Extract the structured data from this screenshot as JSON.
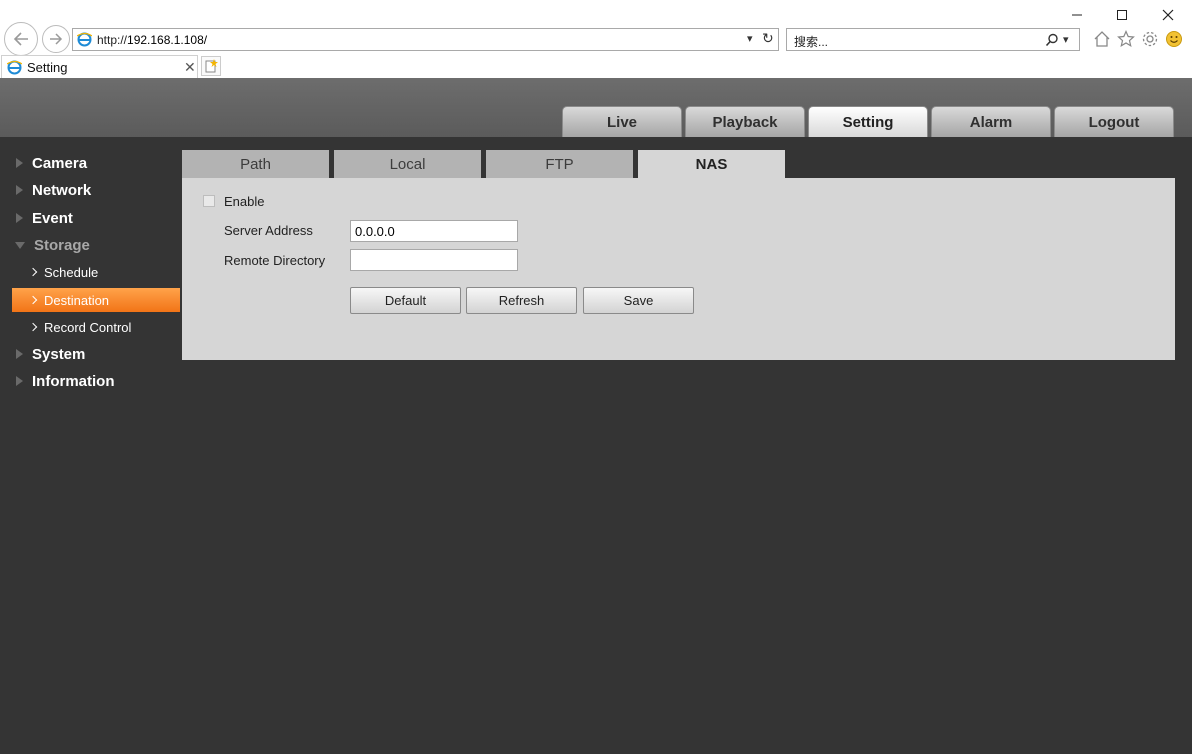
{
  "browser": {
    "url_prefix": "http://",
    "url_host": "192.168.1.108/",
    "search_placeholder": "搜索...",
    "tab_title": "Setting",
    "icons": [
      "back-arrow-icon",
      "forward-arrow-icon",
      "ie-logo-icon",
      "dropdown-icon",
      "refresh-icon",
      "search-icon",
      "home-icon",
      "favorites-star-icon",
      "gear-icon",
      "smiley-icon",
      "minimize-icon",
      "maximize-icon",
      "close-icon",
      "new-tab-icon"
    ]
  },
  "header": {
    "tabs": [
      {
        "label": "Live"
      },
      {
        "label": "Playback"
      },
      {
        "label": "Setting"
      },
      {
        "label": "Alarm"
      },
      {
        "label": "Logout"
      }
    ],
    "active_tab": "Setting"
  },
  "sidebar": {
    "items": [
      {
        "label": "Camera"
      },
      {
        "label": "Network"
      },
      {
        "label": "Event"
      },
      {
        "label": "Storage"
      },
      {
        "label": "System"
      },
      {
        "label": "Information"
      }
    ],
    "storage_children": [
      {
        "label": "Schedule"
      },
      {
        "label": "Destination"
      },
      {
        "label": "Record Control"
      }
    ],
    "active_child": "Destination"
  },
  "content": {
    "tabs": [
      {
        "label": "Path"
      },
      {
        "label": "Local"
      },
      {
        "label": "FTP"
      },
      {
        "label": "NAS"
      }
    ],
    "active_tab": "NAS",
    "form": {
      "enable_label": "Enable",
      "enable_checked": false,
      "server_address_label": "Server Address",
      "server_address_value": "0.0.0.0",
      "remote_directory_label": "Remote Directory",
      "remote_directory_value": ""
    },
    "buttons": {
      "default": "Default",
      "refresh": "Refresh",
      "save": "Save"
    }
  },
  "colors": {
    "background": "#343434",
    "header": "#5e5e5e",
    "active_accent": "#f58a2c",
    "panel": "#d6d6d6"
  }
}
